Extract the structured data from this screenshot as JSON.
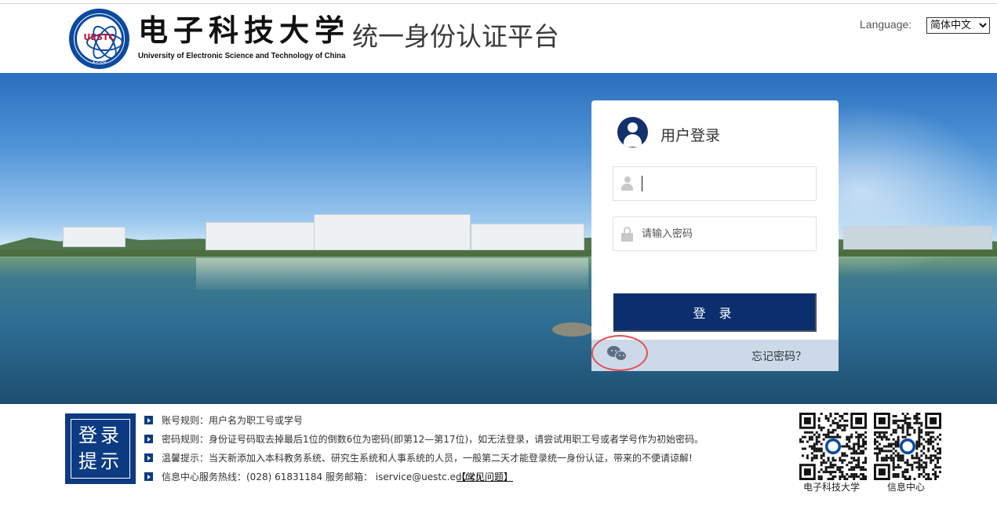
{
  "header": {
    "logo_abbr": "UESTC",
    "logo_year": "1956",
    "school_name_cn": "电子科技大学",
    "school_name_en": "University of Electronic Science and Technology of China",
    "platform_title": "统一身份认证平台",
    "language_label": "Language:",
    "language_selected": "简体中文"
  },
  "login": {
    "title": "用户登录",
    "username_value": "",
    "password_placeholder": "请输入密码",
    "submit_label": "登 录",
    "forgot_label": "忘记密码？",
    "icons": [
      "user-avatar-icon",
      "user-icon",
      "lock-icon",
      "wechat-icon"
    ]
  },
  "footer": {
    "tips_logo_text": "登录提示",
    "tips": [
      "账号规则：用户名为职工号或学号",
      "密码规则：身份证号码取去掉最后1位的倒数6位为密码(即第12—第17位)，如无法登录，请尝试用职工号或者学号作为初始密码。",
      "温馨提示：当天新添加入本科教务系统、研究生系统和人事系统的人员，一般第二天才能登录统一身份认证，带来的不便请谅解!",
      "信息中心服务热线：(028) 61831184 服务邮箱： iservice@uestc.edu.cn"
    ],
    "faq_label": "【常见问题】",
    "qr_labels": [
      "电子科技大学",
      "信息中心"
    ]
  },
  "colors": {
    "brand_navy": "#0b2f6e",
    "logo_blue": "#0c4aa0",
    "footer_bar": "#ccd9e8",
    "highlight_ring": "#e35050"
  }
}
